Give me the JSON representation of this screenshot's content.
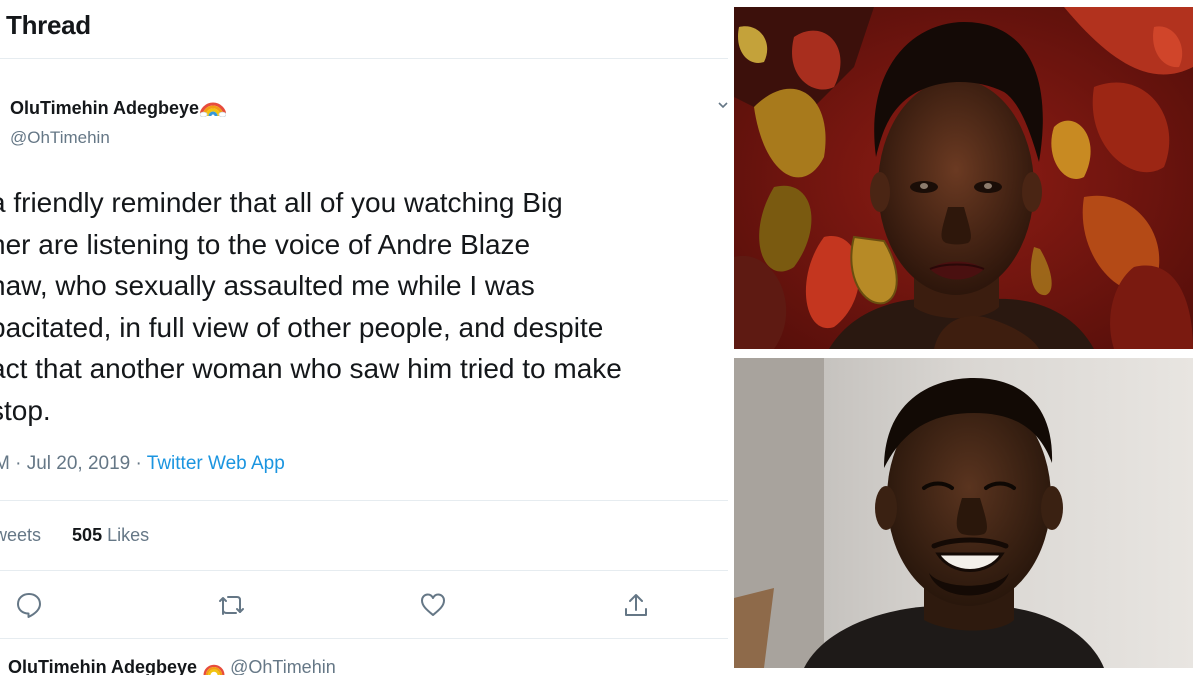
{
  "thread": {
    "title": "Thread"
  },
  "tweet": {
    "author_name": "OluTimehin Adegbeye",
    "author_handle": "@OhTimehin",
    "text": "a friendly reminder that all of you watching Big\nher are listening to the voice of Andre Blaze\nhaw, who sexually assaulted me while I was\npacitated, in full view of other people, and despite\nact that another woman who saw him tried to make\nstop.",
    "time_date": "M · Jul 20, 2019 · ",
    "source": "Twitter Web App",
    "retweets_label": "weets",
    "likes_count": "505",
    "likes_label": "Likes"
  },
  "actions": {
    "reply_icon": "reply-icon",
    "retweet_icon": "retweet-icon",
    "like_icon": "heart-icon",
    "share_icon": "share-icon"
  },
  "next_tweet": {
    "author_name": "OluTimehin Adegbeye",
    "author_handle": "@OhTimehin"
  },
  "photos": {
    "top": "woman-portrait",
    "bottom": "man-portrait"
  },
  "colors": {
    "text": "#14171a",
    "secondary": "#657786",
    "link": "#1b95e0",
    "divider": "#e6ecf0"
  }
}
